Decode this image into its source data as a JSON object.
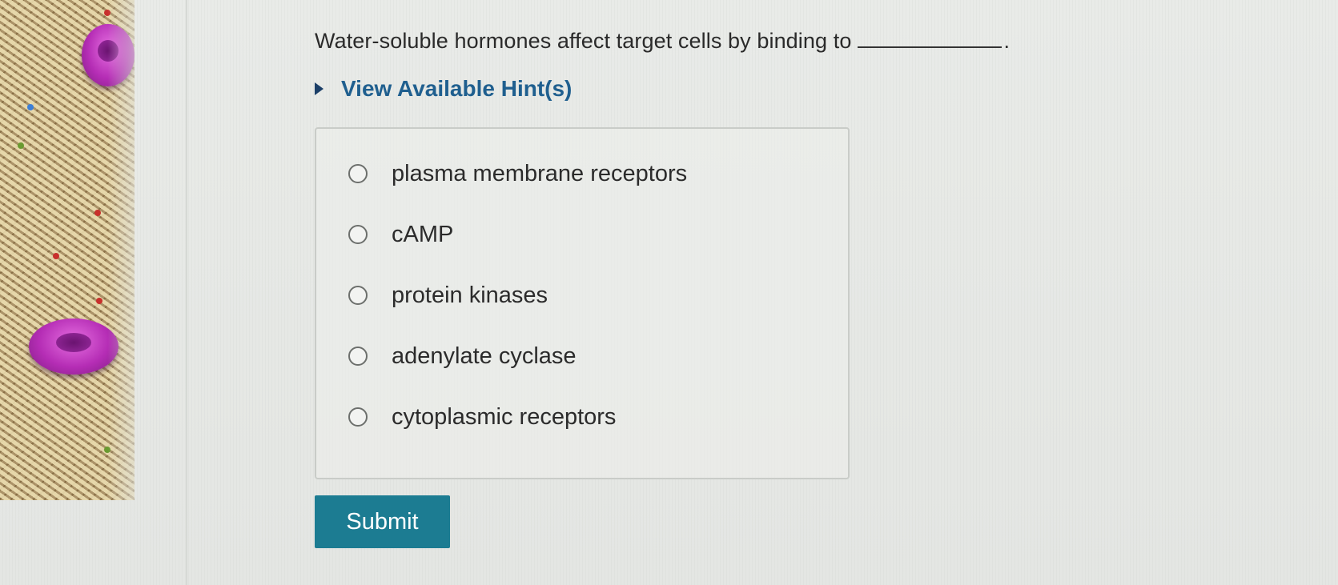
{
  "question": {
    "text": "Water-soluble hormones affect target cells by binding to",
    "end_punct": "."
  },
  "hints": {
    "label": "View Available Hint(s)",
    "icon": "caret-right-icon"
  },
  "options": [
    {
      "label": "plasma membrane receptors"
    },
    {
      "label": "cAMP"
    },
    {
      "label": "protein kinases"
    },
    {
      "label": "adenylate cyclase"
    },
    {
      "label": "cytoplasmic receptors"
    }
  ],
  "submit": {
    "label": "Submit"
  },
  "colors": {
    "accent": "#1c7c92",
    "hint_text": "#1f5f8f"
  }
}
